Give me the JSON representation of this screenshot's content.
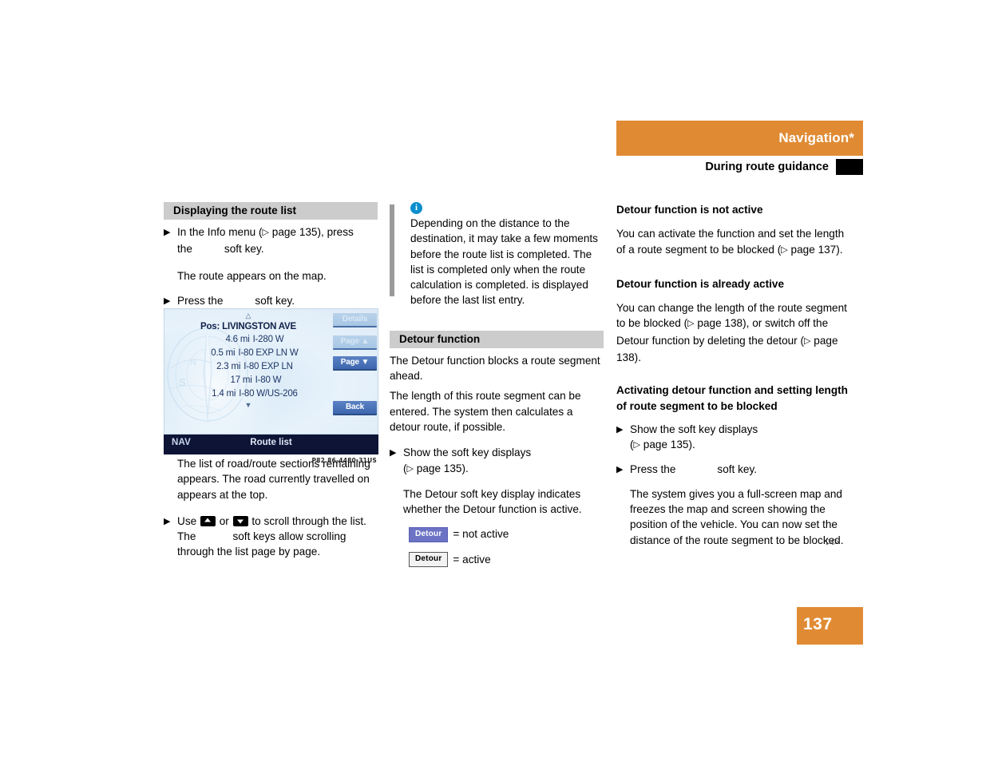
{
  "header": {
    "band_title": "Navigation*",
    "subtitle": "During route guidance"
  },
  "page_number": "137",
  "left_column": {
    "section_title": "Displaying the route list",
    "bullet1_part1": "In the Info menu (",
    "bullet1_ref": "page 135), press",
    "bullet1_line2_a": "the",
    "bullet1_line2_b": "soft key.",
    "result1": "The route appears on the map.",
    "bullet2_a": "Press the",
    "bullet2_b": "soft key.",
    "figure_code": "P82.86-4480-31US",
    "after_figure": "The list of road/route sections remaining appears. The road currently travelled on appears at the top.",
    "bullet3_a": "Use",
    "bullet3_b": "or",
    "bullet3_c": "to scroll through the list. The",
    "bullet3_d": "soft keys allow scrolling through the list page by page."
  },
  "nav_screen": {
    "caret_up": "△",
    "caret_down": "▼",
    "position_label": "Pos: LIVINGSTON AVE",
    "rows": [
      {
        "distance": "4.6 mi",
        "road": "I-280 W"
      },
      {
        "distance": "0.5 mi",
        "road": "I-80 EXP LN W"
      },
      {
        "distance": "2.3 mi",
        "road": "I-80 EXP LN"
      },
      {
        "distance": "17 mi",
        "road": "I-80 W"
      },
      {
        "distance": "1.4 mi",
        "road": "I-80 W/US-206"
      }
    ],
    "softkeys": [
      {
        "label": "Details",
        "state": "dim"
      },
      {
        "label": "Page ▲",
        "state": "dim"
      },
      {
        "label": "Page ▼",
        "state": "on"
      },
      {
        "label": "Back",
        "state": "on"
      }
    ],
    "footer_mode": "NAV",
    "footer_title": "Route list"
  },
  "middle_column": {
    "info_note": "Depending on the distance to the destination, it may take a few moments before the route list is completed. The list is completed only when the route calculation is completed.        is displayed before the last list entry.",
    "info_icon": "i",
    "section_title": "Detour function",
    "para1": "The Detour function blocks a route segment ahead.",
    "para2": "The length of this route segment can be entered. The system then calculates a detour route, if possible.",
    "bullet1_a": "Show the soft key displays",
    "bullet1_b": "page 135).",
    "result1": "The Detour soft key display indicates whether the Detour function is active.",
    "badge_inactive_label": "Detour",
    "badge_inactive_text": "= not active",
    "badge_active_label": "Detour",
    "badge_active_text": "= active"
  },
  "right_column": {
    "head1": "Detour function is not active",
    "para1_a": "You can activate the function and set the length of a route segment to be blocked (",
    "para1_b": "page 137).",
    "head2": "Detour function is already active",
    "para2_a": "You can change the length of the route segment to be blocked (",
    "para2_b": "page 138), or switch off the Detour function by deleting the detour (",
    "para2_c": "page 138).",
    "head3": "Activating detour function and setting length of route segment to be blocked",
    "bullet1_a": "Show the soft key displays",
    "bullet1_b": "page 135).",
    "bullet2_a": "Press the",
    "bullet2_b": "soft key.",
    "result1": "The system gives you a full-screen map and freezes the map and screen showing the position of the vehicle. You can now set the distance of the route segment to be blocked.",
    "continuation": "▷▷"
  },
  "colors": {
    "brand_orange": "#e08b34",
    "section_bar_gray": "#cccccc",
    "nav_footer_navy": "#0d1436",
    "softkey_inactive_blue": "#6c73c4",
    "info_blue": "#0b8ecd"
  }
}
